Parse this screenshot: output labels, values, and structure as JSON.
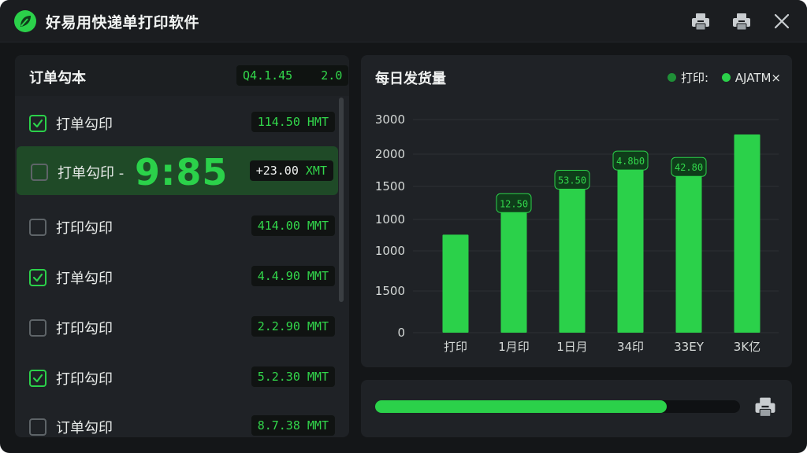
{
  "app": {
    "title": "好易用快递单打印软件"
  },
  "orders": {
    "title": "订单勾本",
    "summary": {
      "code": "Q4.1.45",
      "count": "2.0"
    },
    "rows": [
      {
        "label": "打单勾印",
        "checked": true,
        "amount": "114.50 HMT",
        "selected": false
      },
      {
        "label": "打单勾印 -",
        "checked": false,
        "amount": "+23.00",
        "unit": "XMT",
        "selected": true,
        "big_time": "9:85"
      },
      {
        "label": "打印勾印",
        "checked": false,
        "amount": "414.00 MMT",
        "selected": false
      },
      {
        "label": "打单勾印",
        "checked": true,
        "amount": "4.4.90 MMT",
        "selected": false
      },
      {
        "label": "打印勾印",
        "checked": false,
        "amount": "2.2.90 MMT",
        "selected": false
      },
      {
        "label": "打印勾印",
        "checked": true,
        "amount": "5.2.30 MMT",
        "selected": false
      },
      {
        "label": "订单勾印",
        "checked": false,
        "amount": "8.7.38 MMT",
        "selected": false
      }
    ]
  },
  "chart": {
    "title": "每日发货量",
    "legend": [
      {
        "label": "打印:",
        "color": "#1f8f37"
      },
      {
        "label": "AJATM×",
        "color": "#2bd14a"
      }
    ]
  },
  "chart_data": {
    "type": "bar",
    "title": "每日发货量",
    "ytick_labels": [
      "3000",
      "2000",
      "1500",
      "1000",
      "1000",
      "1500",
      "0"
    ],
    "categories": [
      "打印",
      "1月印",
      "1日月",
      "34印",
      "33EY",
      "3K亿"
    ],
    "values": [
      0.46,
      0.63,
      0.74,
      0.83,
      0.8,
      0.93
    ],
    "value_scale": "fraction of plotted axis height",
    "data_labels": [
      "",
      "12.50",
      "53.50",
      "4.8b0",
      "42.80",
      ""
    ],
    "bar_color": "#2bd14a",
    "grid": true
  },
  "progress": {
    "value": 0.8,
    "color": "#2bd14a"
  },
  "icons": {
    "logo": "leaf-logo-icon",
    "printer": "printer-icon",
    "close": "close-icon",
    "check": "checkmark-icon"
  }
}
